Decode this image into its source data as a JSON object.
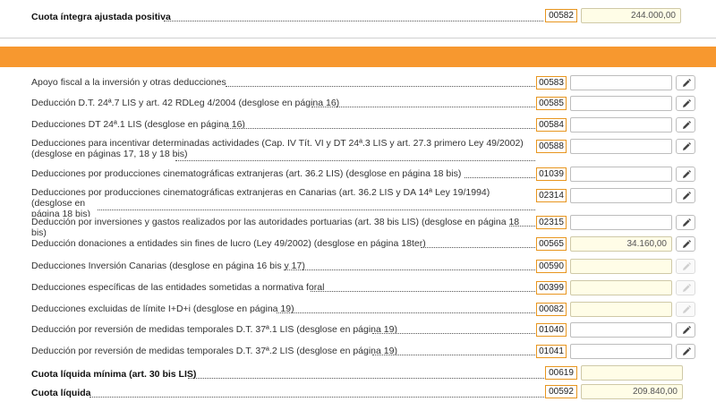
{
  "top": {
    "label": "Cuota íntegra ajustada positiva",
    "code": "00582",
    "value": "244.000,00"
  },
  "rows": [
    {
      "label": "Apoyo fiscal a la inversión y otras deducciones",
      "code": "00583",
      "value": ""
    },
    {
      "label": "Deducción D.T. 24ª.7 LIS y art. 42 RDLeg 4/2004 (desglose en página 16)",
      "code": "00585",
      "value": ""
    },
    {
      "label": "Deducciones DT 24ª.1 LIS (desglose en página 16)",
      "code": "00584",
      "value": ""
    },
    {
      "label": "Deducciones para incentivar determinadas actividades (Cap. IV Tít. VI y DT 24ª.3 LIS y art. 27.3 primero Ley 49/2002)",
      "label2": "(desglose en páginas 17, 18 y 18 bis)",
      "code": "00588",
      "value": ""
    },
    {
      "label": "Deducciones por producciones cinematográficas extranjeras (art. 36.2 LIS) (desglose en página 18 bis)",
      "code": "01039",
      "value": ""
    },
    {
      "label": "Deducciones por producciones cinematográficas extranjeras en Canarias (art. 36.2 LIS y DA 14ª Ley 19/1994) (desglose en",
      "label2": "página 18 bis)",
      "code": "02314",
      "value": ""
    },
    {
      "label": "Deducción por inversiones y gastos realizados por las autoridades portuarias (art. 38 bis LIS) (desglose en página 18 bis)",
      "code": "02315",
      "value": ""
    },
    {
      "label": "Deducción donaciones a entidades sin fines de lucro (Ley 49/2002) (desglose en página 18ter)",
      "code": "00565",
      "value": "34.160,00"
    },
    {
      "label": "Deducciones Inversión Canarias (desglose en página 16 bis y 17)",
      "code": "00590",
      "value": ""
    },
    {
      "label": "Deducciones específicas de las entidades sometidas a normativa foral",
      "code": "00399",
      "value": ""
    },
    {
      "label": "Deducciones excluidas de límite I+D+i (desglose en página 19)",
      "code": "00082",
      "value": ""
    },
    {
      "label": "Deducción por reversión de medidas temporales D.T. 37ª.1 LIS (desglose en página 19)",
      "code": "01040",
      "value": ""
    },
    {
      "label": "Deducción por reversión de medidas temporales D.T. 37ª.2 LIS (desglose en página 19)",
      "code": "01041",
      "value": ""
    }
  ],
  "bottom": [
    {
      "label": "Cuota líquida mínima (art. 30 bis LIS)",
      "code": "00619",
      "value": ""
    },
    {
      "label": "Cuota líquida",
      "code": "00592",
      "value": "209.840,00"
    }
  ],
  "icons": {
    "edit": "pencil-icon"
  },
  "colors": {
    "accent": "#f7982f",
    "code_border": "#e8961f",
    "readonly_bg": "#fffde7"
  }
}
